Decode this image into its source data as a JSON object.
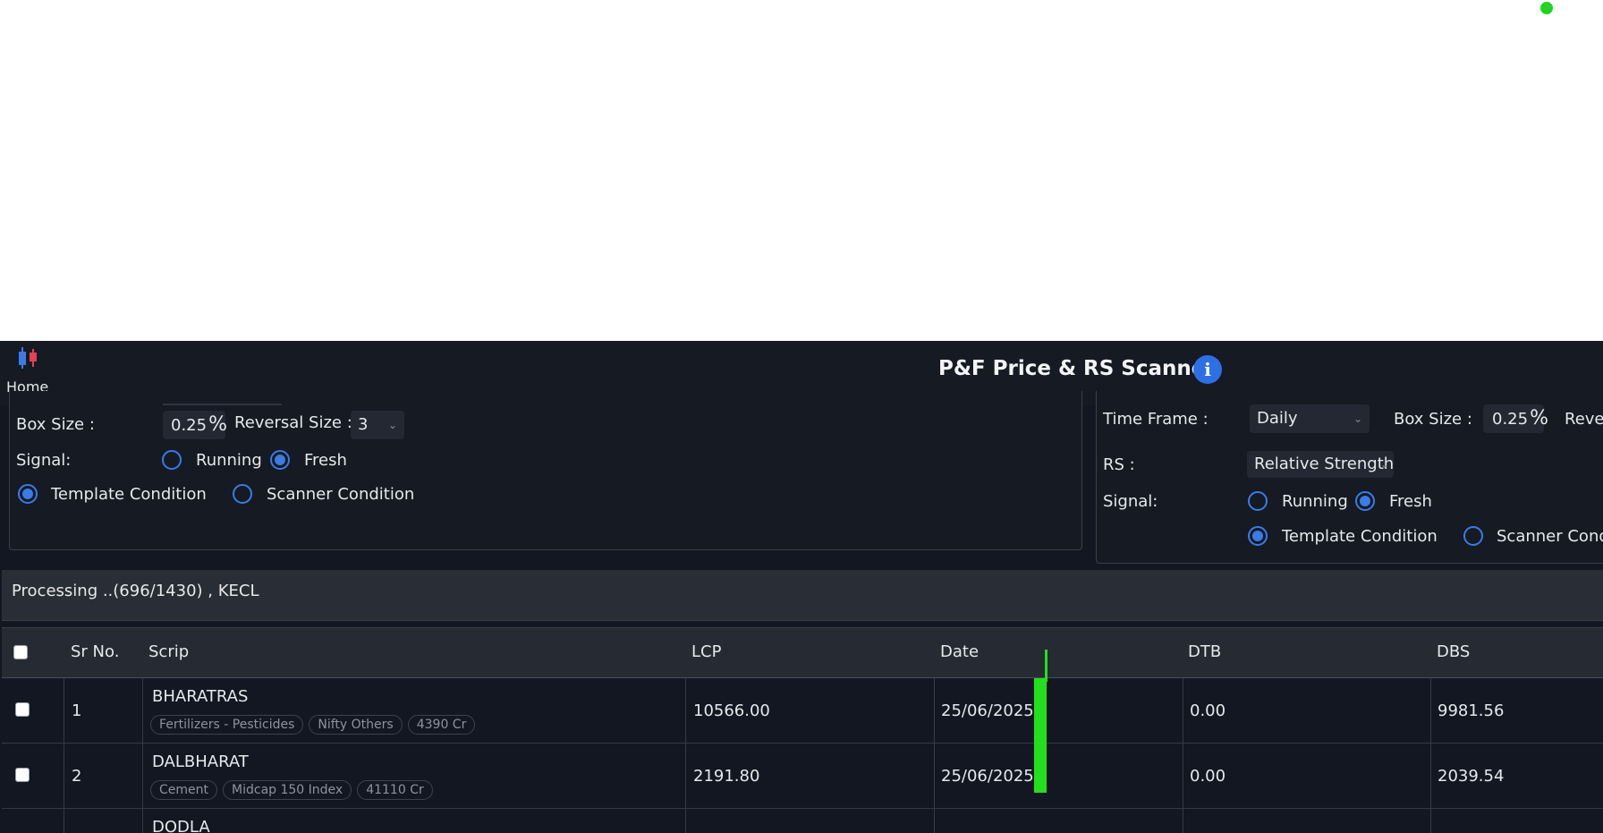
{
  "header": {
    "home_label": "Home",
    "title": "P&F Price & RS Scanner",
    "info_icon": "i"
  },
  "left_panel": {
    "box_size_label": "Box Size :",
    "box_size_value": "0.25",
    "box_size_unit": "%",
    "reversal_label": "Reversal Size :",
    "reversal_value": "3",
    "signal_label": "Signal:",
    "signal_options": [
      "Running",
      "Fresh"
    ],
    "signal_selected": "Fresh",
    "condition_options": [
      "Template Condition",
      "Scanner Condition"
    ],
    "condition_selected": "Template Condition"
  },
  "right_panel": {
    "time_frame_label": "Time Frame :",
    "time_frame_value": "Daily",
    "box_size_label": "Box Size :",
    "box_size_value": "0.25",
    "box_size_unit": "%",
    "reversal_label_partial": "Rever",
    "rs_label": "RS :",
    "rs_value": "Relative Strength",
    "signal_label": "Signal:",
    "signal_options": [
      "Running",
      "Fresh"
    ],
    "signal_selected": "Fresh",
    "condition_options": [
      "Template Condition",
      "Scanner Condi"
    ],
    "condition_selected": "Template Condition"
  },
  "processing": {
    "text": "Processing ..(696/1430) , KECL"
  },
  "table": {
    "columns": [
      "Sr No.",
      "Scrip",
      "LCP",
      "Date",
      "DTB",
      "DBS"
    ],
    "rows": [
      {
        "sr": "1",
        "scrip": "BHARATRAS",
        "tags": [
          "Fertilizers - Pesticides",
          "Nifty Others",
          "4390 Cr"
        ],
        "lcp": "10566.00",
        "date": "25/06/2025",
        "dtb": "0.00",
        "dbs": "9981.56"
      },
      {
        "sr": "2",
        "scrip": "DALBHARAT",
        "tags": [
          "Cement",
          "Midcap 150 Index",
          "41110 Cr"
        ],
        "lcp": "2191.80",
        "date": "25/06/2025",
        "dtb": "0.00",
        "dbs": "2039.54"
      },
      {
        "sr": "",
        "scrip": "DODLA",
        "tags": [],
        "lcp": "",
        "date": "",
        "dtb": "",
        "dbs": ""
      }
    ]
  },
  "colors": {
    "background": "#131722",
    "accent_blue": "#2f6fe4",
    "status_green": "#21d421"
  }
}
